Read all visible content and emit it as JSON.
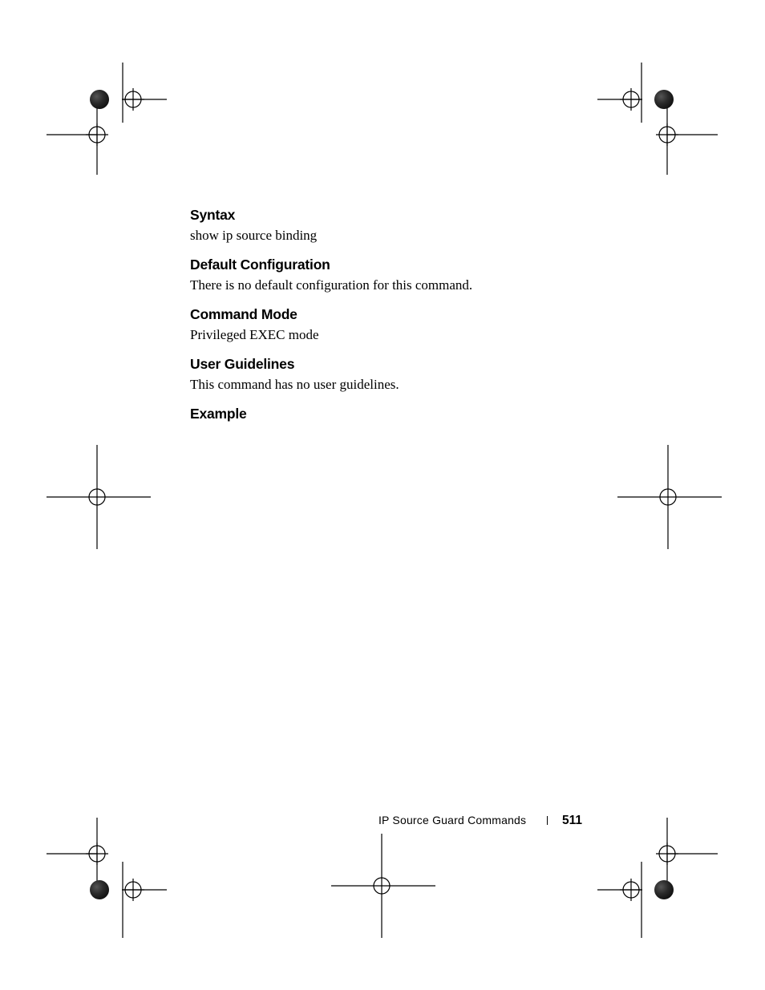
{
  "sections": {
    "syntax": {
      "heading": "Syntax",
      "body": "show ip source binding"
    },
    "default_config": {
      "heading": "Default Configuration",
      "body": "There is no default configuration for this command."
    },
    "command_mode": {
      "heading": "Command Mode",
      "body": "Privileged EXEC mode"
    },
    "user_guidelines": {
      "heading": "User Guidelines",
      "body": "This command has no user guidelines."
    },
    "example": {
      "heading": "Example"
    }
  },
  "footer": {
    "label": "IP Source Guard Commands",
    "page_number": "511"
  }
}
